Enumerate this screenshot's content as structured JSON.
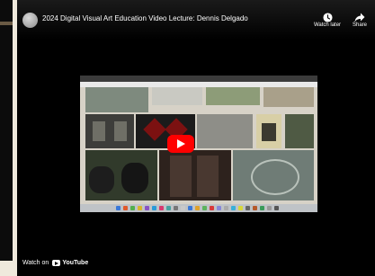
{
  "video": {
    "title": "2024 Digital Visual Art Education Video Lecture: Dennis Delgado",
    "watch_later_label": "Watch later",
    "share_label": "Share",
    "watch_on_label": "Watch on",
    "youtube_label": "YouTube"
  },
  "colors": {
    "play_button": "#ff0000",
    "page_background": "#efe9dc",
    "player_background": "#000000"
  },
  "icons": [
    "clock-icon",
    "share-arrow-icon",
    "play-icon",
    "youtube-logo-icon"
  ]
}
